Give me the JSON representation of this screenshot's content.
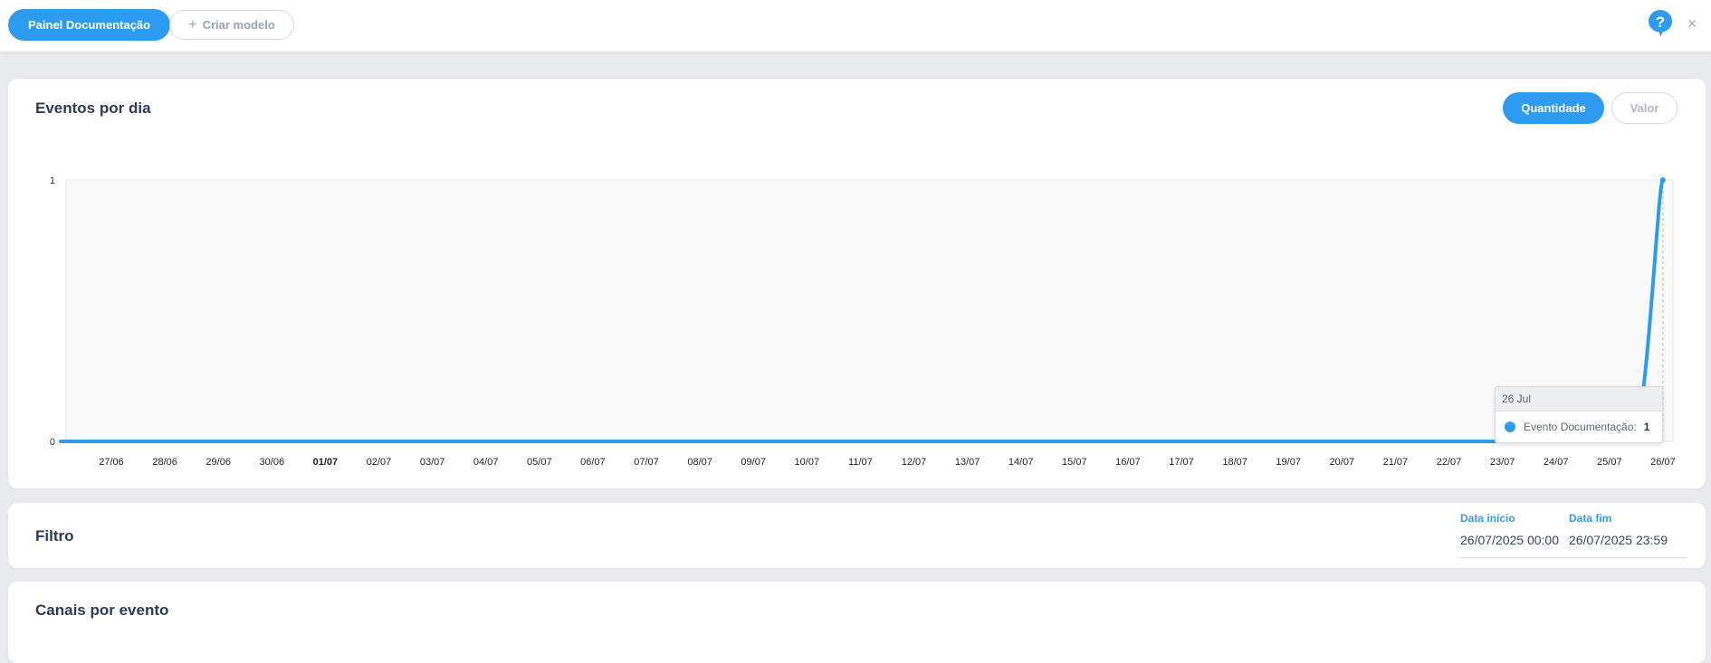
{
  "toolbar": {
    "primary_label": "Painel Documentação",
    "create_label": "Criar modelo",
    "help_icon": "help-question-icon",
    "close_glyph": "×"
  },
  "events_card": {
    "title": "Eventos por dia",
    "toggle": {
      "active": "Quantidade",
      "inactive": "Valor"
    }
  },
  "tooltip": {
    "date": "26 Jul",
    "series": "Evento Documentação:",
    "value": "1"
  },
  "filter": {
    "title": "Filtro",
    "start_label": "Data início",
    "start_value": "26/07/2025 00:00",
    "end_label": "Data fim",
    "end_value": "26/07/2025 23:59"
  },
  "channels": {
    "title": "Canais por evento"
  },
  "colors": {
    "accent": "#2d9cf0",
    "plot_bg": "#f9f9f9"
  },
  "chart_data": {
    "type": "area",
    "categories": [
      "27/06",
      "28/06",
      "29/06",
      "30/06",
      "01/07",
      "02/07",
      "03/07",
      "04/07",
      "05/07",
      "06/07",
      "07/07",
      "08/07",
      "09/07",
      "10/07",
      "11/07",
      "12/07",
      "13/07",
      "14/07",
      "15/07",
      "16/07",
      "17/07",
      "18/07",
      "19/07",
      "20/07",
      "21/07",
      "22/07",
      "23/07",
      "24/07",
      "25/07",
      "26/07"
    ],
    "bold_ticks": [
      "01/07"
    ],
    "series": [
      {
        "name": "Evento Documentação",
        "values": [
          0,
          0,
          0,
          0,
          0,
          0,
          0,
          0,
          0,
          0,
          0,
          0,
          0,
          0,
          0,
          0,
          0,
          0,
          0,
          0,
          0,
          0,
          0,
          0,
          0,
          0,
          0,
          0,
          0,
          1
        ]
      }
    ],
    "yticks": [
      0,
      1
    ],
    "ylim": [
      0,
      1
    ],
    "grid": false,
    "legend": "none"
  }
}
